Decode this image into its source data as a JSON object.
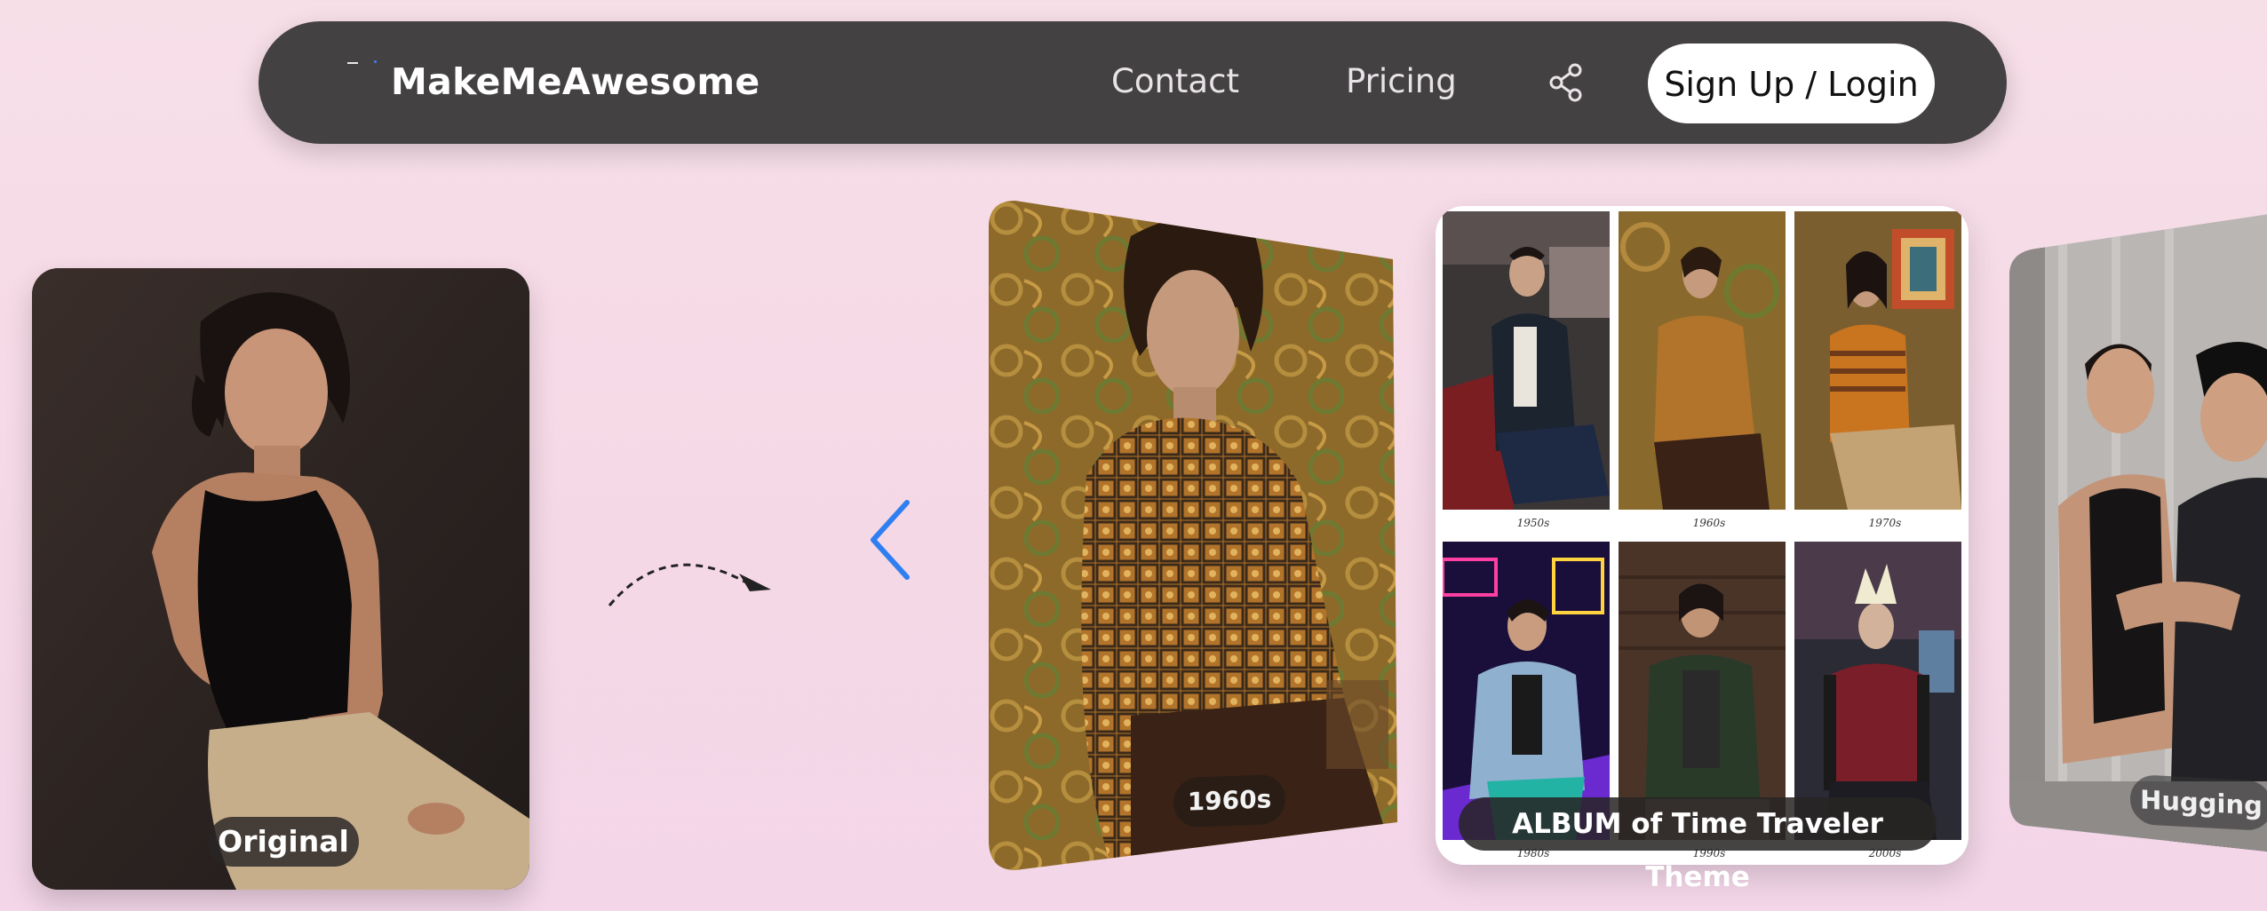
{
  "navbar": {
    "brand": "MakeMeAwesome",
    "links": {
      "contact": "Contact",
      "pricing": "Pricing"
    },
    "share_icon": "share-icon",
    "signup_label": "Sign Up / Login"
  },
  "hero": {
    "original_label": "Original",
    "transform_arrow_icon": "curved-dashed-arrow-icon",
    "prev_icon": "chevron-left-icon",
    "cards": [
      {
        "label": "1960s"
      },
      {
        "label": "ALBUM of Time Traveler Theme"
      },
      {
        "label": "Hugging"
      }
    ],
    "album_cells": [
      "1950s",
      "1960s",
      "1970s",
      "1980s",
      "1990s",
      "2000s"
    ]
  },
  "colors": {
    "navbar_bg": "#444143",
    "page_bg": "#f7dfe8",
    "accent": "#2f7ff0",
    "pill_bg": "#2a2525"
  }
}
